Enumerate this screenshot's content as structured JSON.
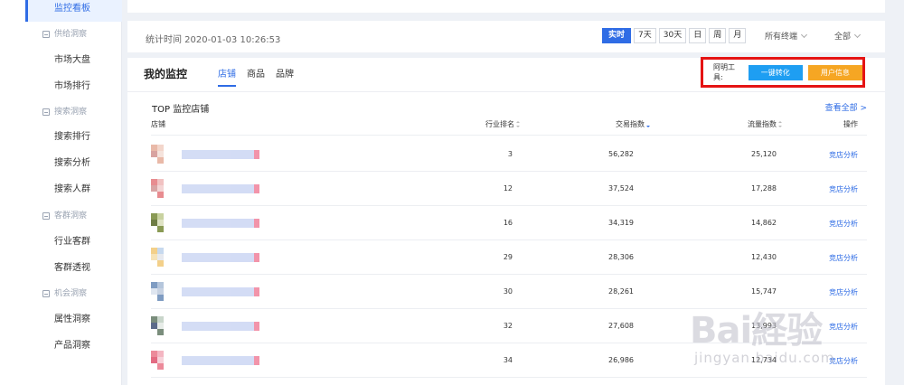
{
  "sidebar": {
    "active_item": "监控看板",
    "groups": [
      {
        "title": "供给洞察",
        "items": [
          "市场大盘",
          "市场排行"
        ]
      },
      {
        "title": "搜索洞察",
        "items": [
          "搜索排行",
          "搜索分析",
          "搜索人群"
        ]
      },
      {
        "title": "客群洞察",
        "items": [
          "行业客群",
          "客群透视"
        ]
      },
      {
        "title": "机会洞察",
        "items": [
          "属性洞察",
          "产品洞察"
        ]
      }
    ]
  },
  "stats_bar": {
    "time_label": "统计时间 2020-01-03 10:26:53",
    "ranges": [
      "实时",
      "7天",
      "30天",
      "日",
      "周",
      "月"
    ],
    "active_range": "实时",
    "terminal_select": "所有终端",
    "scope_select": "全部"
  },
  "monitor": {
    "title": "我的监控",
    "tabs": [
      "店铺",
      "商品",
      "品牌"
    ],
    "active_tab": "店铺",
    "toolbox": {
      "label": "阿明工具:",
      "convert_button": "一键转化",
      "user_button": "用户信息"
    },
    "section_title": "TOP 监控店铺",
    "view_all": "查看全部 >",
    "columns": [
      "店铺",
      "行业排名",
      "交易指数",
      "流量指数",
      "操作"
    ],
    "rows": [
      {
        "rank": "3",
        "trade": "56,282",
        "flow": "25,120",
        "action": "竞店分析"
      },
      {
        "rank": "12",
        "trade": "37,524",
        "flow": "17,288",
        "action": "竞店分析"
      },
      {
        "rank": "16",
        "trade": "34,319",
        "flow": "14,862",
        "action": "竞店分析"
      },
      {
        "rank": "29",
        "trade": "28,306",
        "flow": "12,430",
        "action": "竞店分析"
      },
      {
        "rank": "30",
        "trade": "28,261",
        "flow": "15,747",
        "action": "竞店分析"
      },
      {
        "rank": "32",
        "trade": "27,608",
        "flow": "13,993",
        "action": "竞店分析"
      },
      {
        "rank": "34",
        "trade": "26,986",
        "flow": "12,734",
        "action": "竞店分析"
      }
    ]
  },
  "watermark": {
    "brand": "Bai経验",
    "url": "jingyan.baidu.com"
  },
  "colors": {
    "accent": "#2f6ce5",
    "toolbox_border": "#e51414",
    "convert": "#1e9ef2",
    "user": "#f6a623"
  }
}
